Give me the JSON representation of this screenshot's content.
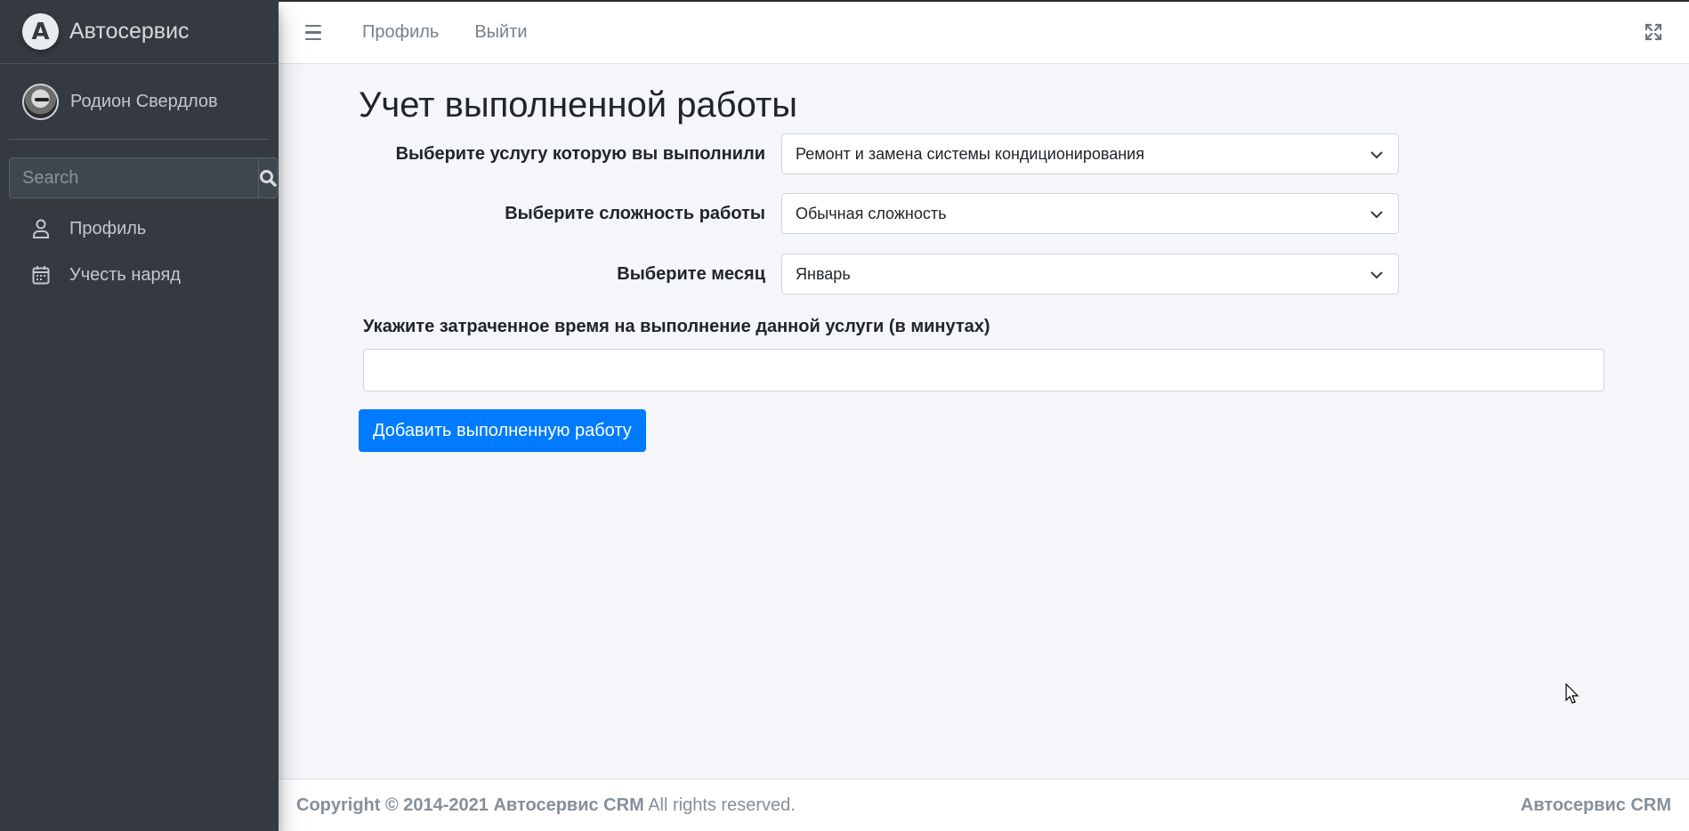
{
  "brand": {
    "name": "Автосервис",
    "logo_letter": "A"
  },
  "user": {
    "name": "Родион Свердлов"
  },
  "search": {
    "placeholder": "Search"
  },
  "sidebar": {
    "items": [
      {
        "label": "Профиль",
        "icon": "user-icon"
      },
      {
        "label": "Учесть наряд",
        "icon": "calendar-icon"
      }
    ]
  },
  "topbar": {
    "links": [
      "Профиль",
      "Выйти"
    ]
  },
  "page": {
    "title": "Учет выполненной работы"
  },
  "form": {
    "service_label": "Выберите услугу которую вы выполнили",
    "service_value": "Ремонт и замена системы кондиционирования",
    "complexity_label": "Выберите сложность работы",
    "complexity_value": "Обычная сложность",
    "month_label": "Выберите месяц",
    "month_value": "Январь",
    "time_label": "Укажите затраченное время на выполнение данной услуги (в минутах)",
    "time_value": "",
    "submit_label": "Добавить выполненную работу"
  },
  "footer": {
    "copyright_bold": "Copyright © 2014-2021 Автосервис CRM",
    "copyright_rest": " All rights reserved.",
    "right_brand": "Автосервис CRM"
  },
  "colors": {
    "sidebar": "#343a40",
    "primary": "#007bff",
    "background": "#f4f6f9"
  }
}
